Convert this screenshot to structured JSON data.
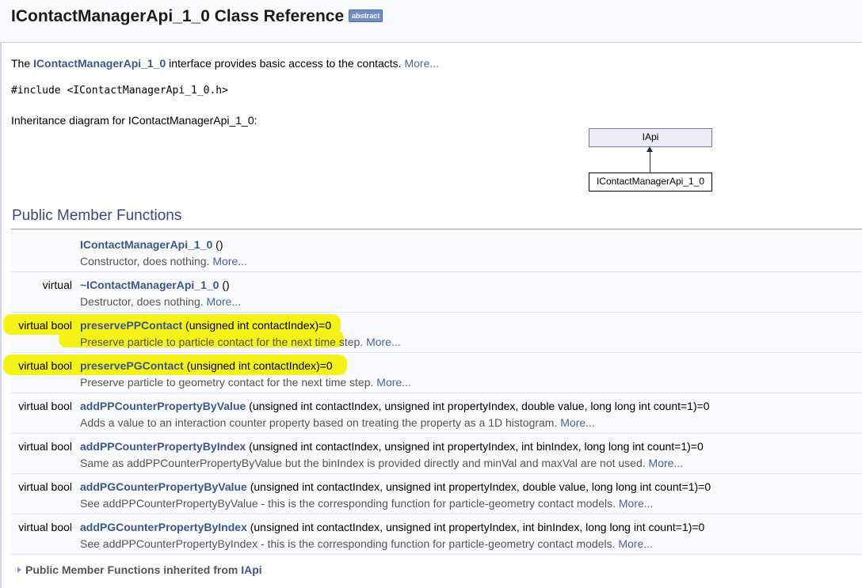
{
  "header": {
    "title": "IContactManagerApi_1_0 Class Reference",
    "badge": "abstract"
  },
  "brief": {
    "prefix": "The ",
    "class_link": "IContactManagerApi_1_0",
    "text": " interface provides basic access to the contacts. ",
    "more": "More..."
  },
  "include_line": "#include <IContactManagerApi_1_0.h>",
  "inheritance": {
    "caption": "Inheritance diagram for IContactManagerApi_1_0:",
    "base": "IApi",
    "derived": "IContactManagerApi_1_0"
  },
  "section_title": "Public Member Functions",
  "members": [
    {
      "left": "",
      "name": "IContactManagerApi_1_0",
      "args": " ()",
      "desc": "Constructor, does nothing. ",
      "more": "More..."
    },
    {
      "left": "virtual",
      "name": "~IContactManagerApi_1_0",
      "args": " ()",
      "desc": "Destructor, does nothing. ",
      "more": "More..."
    },
    {
      "left": "virtual bool",
      "name": "preservePPContact",
      "args": " (unsigned int contactIndex)=0",
      "desc": "Preserve particle to particle contact for the next time step. ",
      "more": "More...",
      "highlight": true
    },
    {
      "left": "virtual bool",
      "name": "preservePGContact",
      "args": " (unsigned int contactIndex)=0",
      "desc": "Preserve particle to geometry contact for the next time step. ",
      "more": "More...",
      "highlight": true
    },
    {
      "left": "virtual bool",
      "name": "addPPCounterPropertyByValue",
      "args": " (unsigned int contactIndex, unsigned int propertyIndex, double value, long long int count=1)=0",
      "desc": "Adds a value to an interaction counter property based on treating the property as a 1D histogram. ",
      "more": "More..."
    },
    {
      "left": "virtual bool",
      "name": "addPPCounterPropertyByIndex",
      "args": " (unsigned int contactIndex, unsigned int propertyIndex, int binIndex, long long int count=1)=0",
      "desc": "Same as addPPCounterPropertyByValue but the binIndex is provided directly and minVal and maxVal are not used. ",
      "more": "More..."
    },
    {
      "left": "virtual bool",
      "name": "addPGCounterPropertyByValue",
      "args": " (unsigned int contactIndex, unsigned int propertyIndex, double value, long long int count=1)=0",
      "desc": "See addPPCounterPropertyByValue - this is the corresponding function for particle-geometry contact models. ",
      "more": "More..."
    },
    {
      "left": "virtual bool",
      "name": "addPGCounterPropertyByIndex",
      "args": " (unsigned int contactIndex, unsigned int propertyIndex, int binIndex, long long int count=1)=0",
      "desc": "See addPPCounterPropertyByIndex - this is the corresponding function for particle-geometry contact models. ",
      "more": "More..."
    }
  ],
  "inherited": {
    "label": "Public Member Functions inherited from ",
    "link": "IApi"
  },
  "colors": {
    "link": "#3d578c",
    "highlight": "#f4f219",
    "row_bg": "#f9fafc"
  }
}
